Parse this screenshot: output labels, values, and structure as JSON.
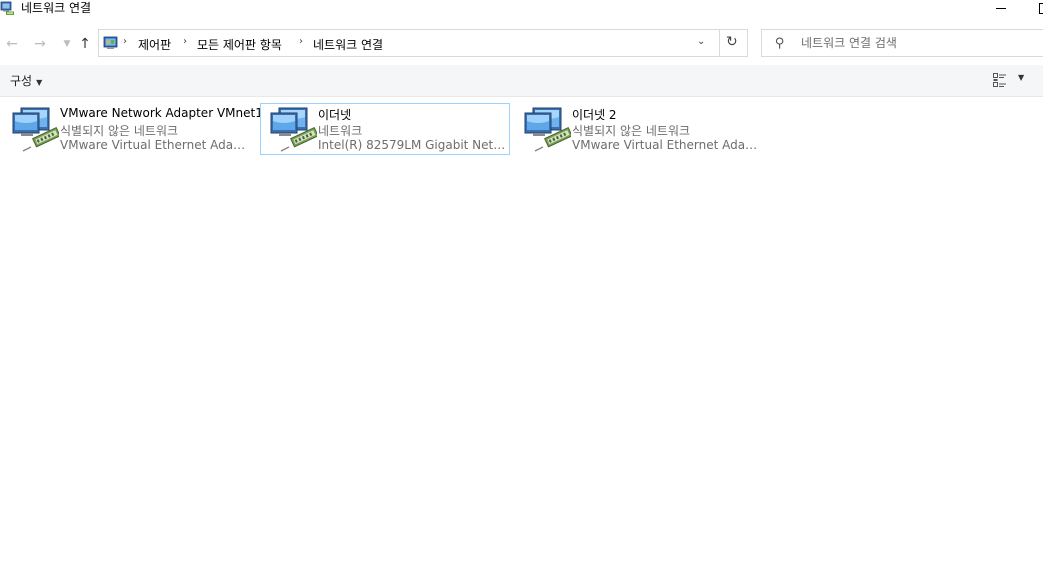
{
  "window": {
    "title": "네트워크 연결",
    "app_icon": "network-connections-icon"
  },
  "navigation": {
    "back_icon": "back-arrow-icon",
    "forward_icon": "forward-arrow-icon",
    "recent_icon": "chevron-down-icon",
    "up_icon": "up-arrow-icon"
  },
  "address": {
    "breadcrumbs": [
      "제어판",
      "모든 제어판 항목",
      "네트워크 연결"
    ],
    "dropdown_icon": "chevron-down-icon",
    "refresh_icon": "refresh-icon"
  },
  "search": {
    "placeholder": "네트워크 연결 검색",
    "icon": "search-icon"
  },
  "commandbar": {
    "organize_label": "구성",
    "view_icon": "details-view-icon",
    "view_dropdown_icon": "chevron-down-icon"
  },
  "connections": [
    {
      "name": "VMware Network Adapter VMnet1",
      "status": "식별되지 않은 네트워크",
      "device": "VMware Virtual Ethernet Adapter...",
      "selected": false
    },
    {
      "name": "이더넷",
      "status": "네트워크",
      "device": "Intel(R) 82579LM Gigabit Netwo...",
      "selected": true
    },
    {
      "name": "이더넷 2",
      "status": "식별되지 않은 네트워크",
      "device": "VMware Virtual Ethernet Adapter...",
      "selected": false
    }
  ],
  "colors": {
    "selection_border": "#99d1ff",
    "commandbar_bg": "#f5f6f7",
    "secondary_text": "#6d6d6d"
  }
}
